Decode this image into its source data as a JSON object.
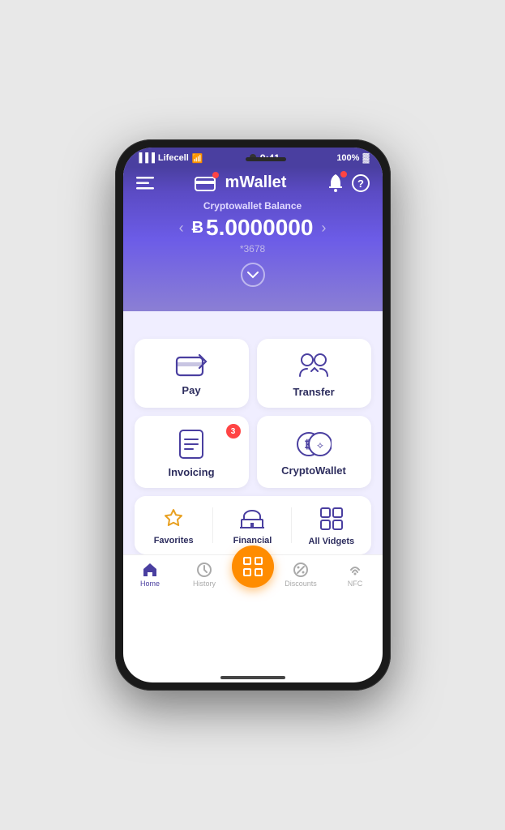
{
  "phone": {
    "status": {
      "carrier": "Lifecell",
      "wifi": true,
      "time": "9:41",
      "battery": "100%"
    }
  },
  "header": {
    "title": "mWallet",
    "menu_label": "menu",
    "card_label": "card",
    "bell_label": "bell",
    "help_label": "help"
  },
  "balance": {
    "label": "Cryptowallet Balance",
    "symbol": "B",
    "amount": "5.0000000",
    "account": "*3678",
    "prev_arrow": "‹",
    "next_arrow": "›"
  },
  "actions": [
    {
      "id": "pay",
      "label": "Pay",
      "icon": "pay",
      "badge": null
    },
    {
      "id": "transfer",
      "label": "Transfer",
      "icon": "transfer",
      "badge": null
    },
    {
      "id": "invoicing",
      "label": "Invoicing",
      "icon": "invoice",
      "badge": "3"
    },
    {
      "id": "cryptowallet",
      "label": "CryptoWallet",
      "icon": "crypto",
      "badge": null
    }
  ],
  "shortcuts": [
    {
      "id": "favorites",
      "label": "Favorites",
      "icon": "star"
    },
    {
      "id": "financial",
      "label": "Financial",
      "icon": "bank"
    },
    {
      "id": "allwidgets",
      "label": "All Vidgets",
      "icon": "grid"
    }
  ],
  "nav": [
    {
      "id": "home",
      "label": "Home",
      "icon": "home",
      "active": true
    },
    {
      "id": "history",
      "label": "History",
      "icon": "clock",
      "active": false
    },
    {
      "id": "scan",
      "label": "Scan",
      "icon": "scan",
      "active": false,
      "center": true
    },
    {
      "id": "discounts",
      "label": "Discounts",
      "icon": "percent",
      "active": false
    },
    {
      "id": "nfc",
      "label": "NFC",
      "icon": "nfc",
      "active": false
    }
  ],
  "colors": {
    "accent": "#4a3fa0",
    "orange": "#ff8c00",
    "badge_red": "#ff4444",
    "star": "#e8a020"
  }
}
